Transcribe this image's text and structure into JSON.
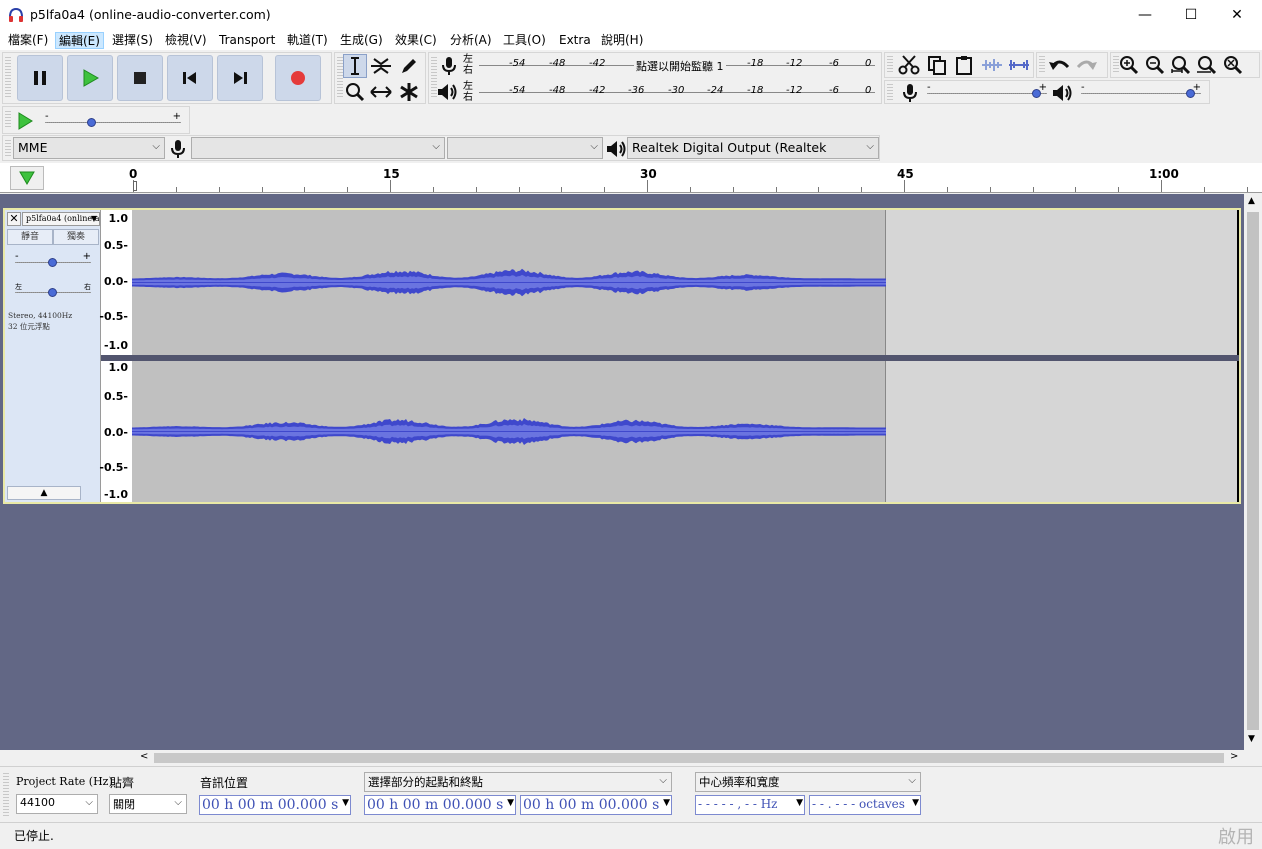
{
  "window": {
    "title": "p5lfa0a4 (online-audio-converter.com)",
    "minimize": "—",
    "maximize": "☐",
    "close": "✕"
  },
  "menu": [
    "檔案(F)",
    "編輯(E)",
    "選擇(S)",
    "檢視(V)",
    "Transport",
    "軌道(T)",
    "生成(G)",
    "效果(C)",
    "分析(A)",
    "工具(O)",
    "Extra",
    "說明(H)"
  ],
  "meters": {
    "record": {
      "l": "左",
      "r": "右",
      "ticks": [
        "-54",
        "-48",
        "-42",
        "-18",
        "-12",
        "-6",
        "0"
      ],
      "note": "點選以開始監聽 1"
    },
    "play": {
      "l": "左",
      "r": "右",
      "ticks": [
        "-54",
        "-48",
        "-42",
        "-36",
        "-30",
        "-24",
        "-18",
        "-12",
        "-6",
        "0"
      ]
    }
  },
  "mixer": {
    "minus": "-",
    "plus": "+",
    "record_volume": 0.95,
    "playback_volume": 0.95
  },
  "playspeed": {
    "minus": "-",
    "plus": "+",
    "speed": 0.33
  },
  "device": {
    "host": "MME",
    "record_device": "",
    "record_channels": "",
    "playback_device": "Realtek Digital Output (Realtek"
  },
  "ruler": {
    "labels": [
      "0",
      "15",
      "30",
      "45",
      "1:00"
    ]
  },
  "track": {
    "name": "p5lfa0a4 (online-a",
    "mute": "靜音",
    "solo": "獨奏",
    "gain_minus": "-",
    "gain_plus": "+",
    "gain": 0.5,
    "pan_left": "左",
    "pan_right": "右",
    "pan": 0.5,
    "info_line1": "Stereo, 44100Hz",
    "info_line2": "32 位元浮點",
    "scale": [
      "1.0",
      "0.5-",
      "0.0-",
      "-0.5-",
      "-1.0"
    ],
    "colors": {
      "wave": "#3f48cc",
      "wave_light": "#6a74e0",
      "selected_bg": "#c0c0c0",
      "empty_bg": "#d6d6d6",
      "track_border": "#e9e9a6",
      "background": "#626785"
    }
  },
  "bottom": {
    "project_rate_label": "Project Rate (Hz)",
    "project_rate": "44100",
    "snap_label": "貼齊",
    "snap": "關閉",
    "audio_position_label": "音訊位置",
    "audio_position": "00 h 00 m 00.000 s",
    "selection_label": "選擇部分的起點和終點",
    "selection_start": "00 h 00 m 00.000 s",
    "selection_end": "00 h 00 m 00.000 s",
    "spectral_label": "中心頻率和寬度",
    "center_freq": "- - - - - , - - Hz",
    "width": "- - . - - - octaves"
  },
  "status": {
    "text": "已停止.",
    "watermark": "啟用"
  }
}
